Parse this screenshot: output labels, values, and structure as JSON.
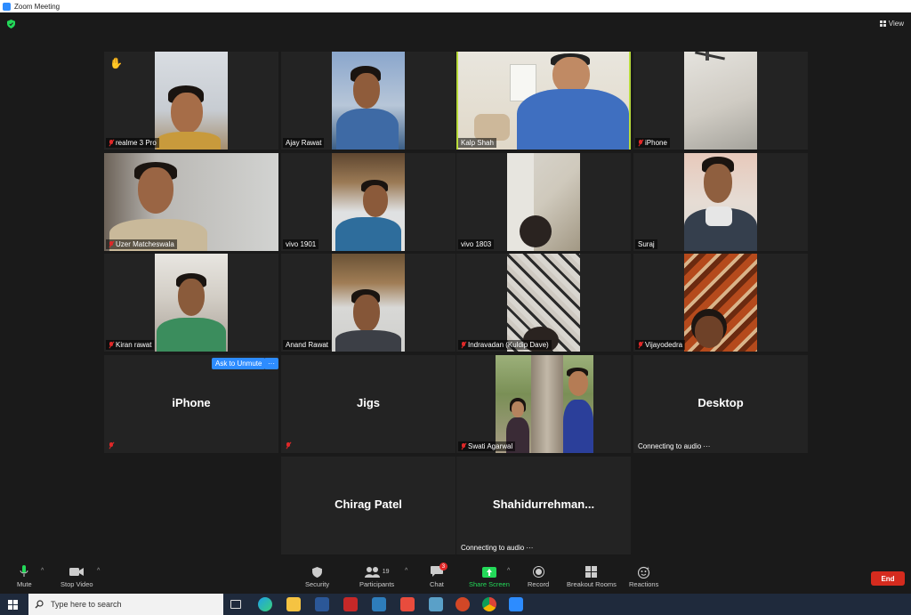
{
  "window": {
    "title": "Zoom Meeting"
  },
  "header": {
    "view_label": "View"
  },
  "participants": [
    {
      "name": "realme 3 Pro",
      "muted": true,
      "hand_raised": true
    },
    {
      "name": "Ajay Rawat",
      "muted": false
    },
    {
      "name": "Kalp Shah",
      "muted": false,
      "active_speaker": true
    },
    {
      "name": "iPhone",
      "muted": true
    },
    {
      "name": "Uzer Matcheswala",
      "muted": true
    },
    {
      "name": "vivo 1901",
      "muted": false
    },
    {
      "name": "vivo 1803",
      "muted": false
    },
    {
      "name": "Suraj",
      "muted": false
    },
    {
      "name": "Kiran rawat",
      "muted": true
    },
    {
      "name": "Anand Rawat",
      "muted": false
    },
    {
      "name": "Indravadan (Kuldip Dave)",
      "muted": true
    },
    {
      "name": "Vijayodedra",
      "muted": true
    },
    {
      "name": "iPhone",
      "muted": true,
      "video_off": true
    },
    {
      "name": "Jigs",
      "muted": true,
      "video_off": true
    },
    {
      "name": "Swati Agarwal",
      "muted": true
    },
    {
      "name": "Desktop",
      "video_off": true,
      "status": "Connecting to audio ···"
    },
    {
      "name": "Chirag Patel",
      "video_off": true
    },
    {
      "name": "Shahidurrehman...",
      "video_off": true,
      "status": "Connecting to audio ···"
    }
  ],
  "tile_actions": {
    "ask_unmute": "Ask to Unmute",
    "more": "···"
  },
  "toolbar": {
    "mute": "Mute",
    "stop_video": "Stop Video",
    "security": "Security",
    "participants": "Participants",
    "participants_count": "19",
    "chat": "Chat",
    "chat_badge": "3",
    "share_screen": "Share Screen",
    "record": "Record",
    "breakout_rooms": "Breakout Rooms",
    "reactions": "Reactions",
    "end": "End"
  },
  "taskbar": {
    "search_placeholder": "Type here to search"
  },
  "colors": {
    "active_speaker": "#b9dc3b",
    "zoom_blue": "#2d8cff",
    "end_red": "#d52b1e",
    "share_green": "#23d959"
  }
}
